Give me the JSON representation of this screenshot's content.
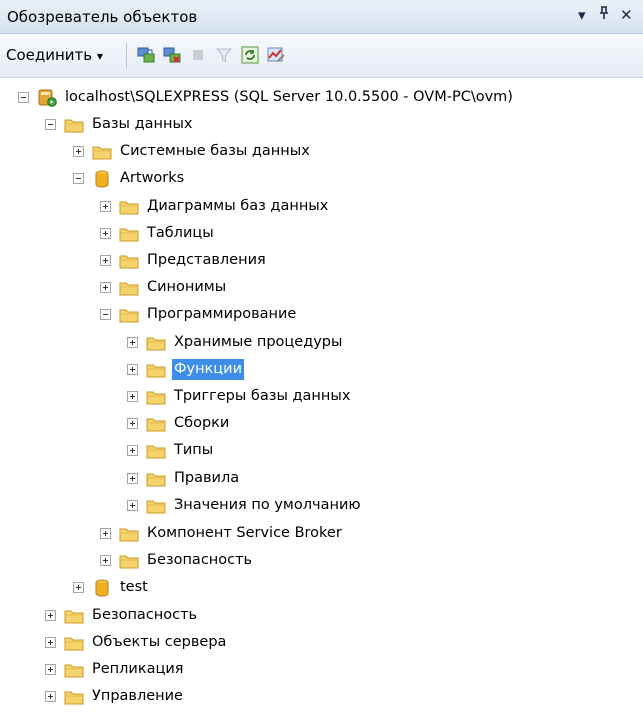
{
  "panel": {
    "title": "Обозреватель объектов",
    "dropdown_glyph": "▾",
    "pin_glyph": "ᅲ",
    "close_glyph": "✕"
  },
  "toolbar": {
    "connect_label": "Соединить",
    "connect_arrow": "▾",
    "icons": [
      "connect-object-explorer-icon",
      "disconnect-icon",
      "stop-icon",
      "filter-icon",
      "refresh-icon",
      "activity-monitor-icon"
    ]
  },
  "tree": {
    "server": "localhost\\SQLEXPRESS (SQL Server 10.0.5500 - OVM-PC\\ovm)",
    "databases": "Базы данных",
    "system_databases": "Системные базы данных",
    "db_artworks": "Artworks",
    "diagrams": "Диаграммы баз данных",
    "tables": "Таблицы",
    "views": "Представления",
    "synonyms": "Синонимы",
    "programmability": "Программирование",
    "stored_procedures": "Хранимые процедуры",
    "functions": "Функции",
    "db_triggers": "Триггеры базы данных",
    "assemblies": "Сборки",
    "types": "Типы",
    "rules": "Правила",
    "defaults": "Значения по умолчанию",
    "service_broker": "Компонент Service Broker",
    "db_security": "Безопасность",
    "db_test": "test",
    "security": "Безопасность",
    "server_objects": "Объекты сервера",
    "replication": "Репликация",
    "management": "Управление"
  },
  "colors": {
    "folder": "#f2c94c",
    "selection": "#3d8ee6",
    "database": "#f0b01e"
  }
}
